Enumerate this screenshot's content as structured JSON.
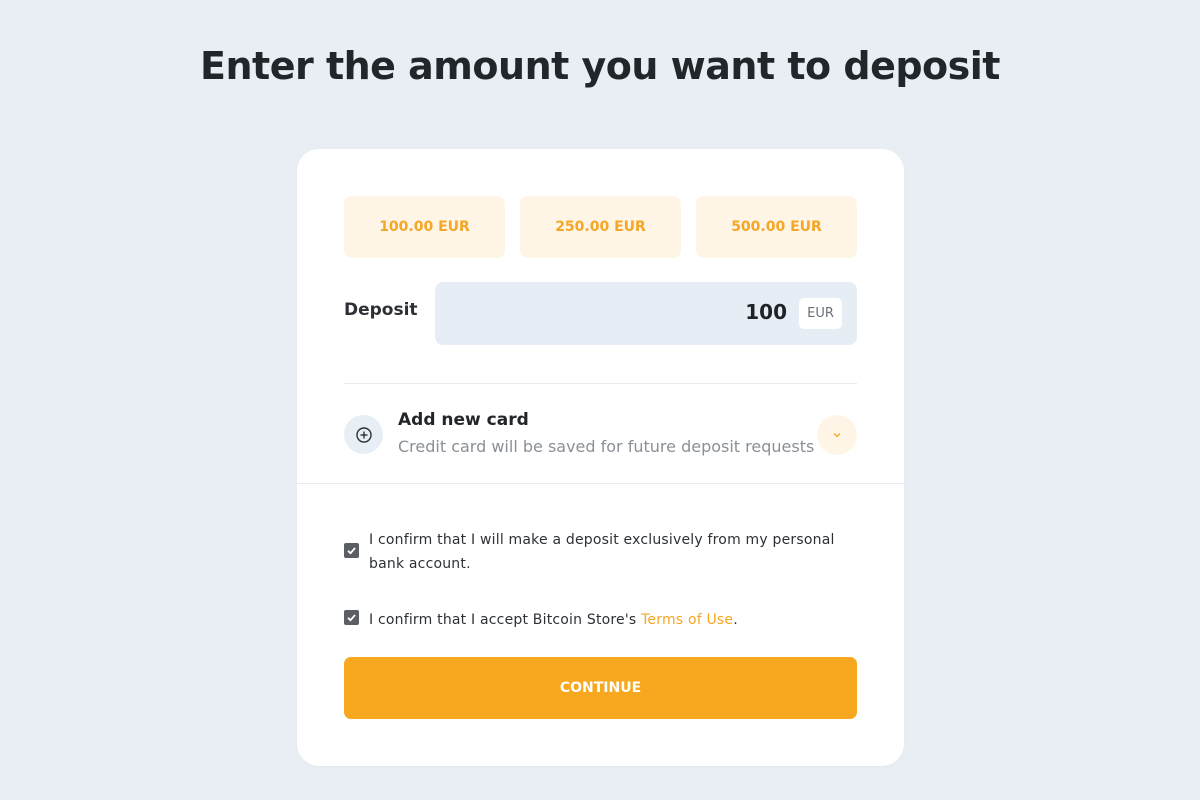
{
  "header": {
    "title": "Enter the amount you want to deposit"
  },
  "presets": [
    {
      "label": "100.00 EUR"
    },
    {
      "label": "250.00 EUR"
    },
    {
      "label": "500.00 EUR"
    }
  ],
  "deposit": {
    "label": "Deposit",
    "value": "100",
    "currency": "EUR"
  },
  "add_card": {
    "title": "Add new card",
    "subtitle": "Credit card will be saved for future deposit requests",
    "icon": "plus-circle-icon",
    "toggle_icon": "chevron-down-icon"
  },
  "confirmations": [
    {
      "checked": true,
      "text": "I confirm that I will make a deposit exclusively from my personal bank account."
    },
    {
      "checked": true,
      "text_before": "I confirm that I accept Bitcoin Store's ",
      "link_text": "Terms of Use",
      "text_after": "."
    }
  ],
  "continue_button": {
    "label": "CONTINUE"
  },
  "colors": {
    "accent": "#f7a81f",
    "accent_soft": "#fff5e6",
    "background": "#e8eef4",
    "field_background": "#e6edf4",
    "checkbox": "#5b5f63"
  }
}
